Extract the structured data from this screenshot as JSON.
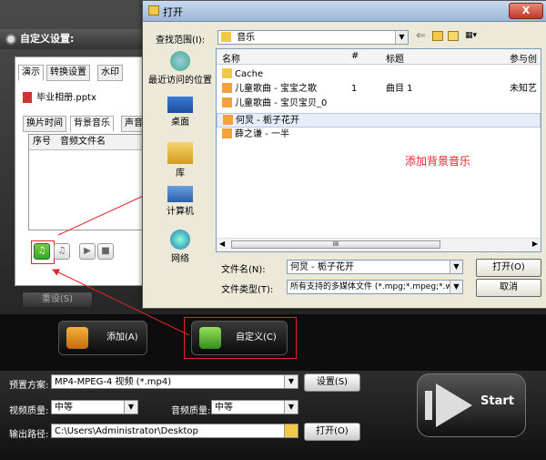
{
  "app": {
    "title": "自定义设置:",
    "tabs": [
      "演示",
      "转换设置",
      "水印"
    ],
    "file_name": "毕业相册.pptx",
    "subtabs": [
      "换片时间",
      "背景音乐",
      "声音"
    ],
    "table_headers": [
      "序号",
      "音频文件名"
    ],
    "reset_label": "重设(S)",
    "add_label": "添加(A)",
    "customize_label": "自定义(C)",
    "preset_label": "预置方案:",
    "preset_value": "MP4-MPEG-4 视频 (*.mp4)",
    "settings_label": "设置(S)",
    "video_quality_label": "视频质量:",
    "video_quality_value": "中等",
    "audio_quality_label": "音频质量:",
    "audio_quality_value": "中等",
    "output_path_label": "输出路径:",
    "output_path_value": "C:\\Users\\Administrator\\Desktop",
    "open_label": "打开(O)",
    "start_label": "Start"
  },
  "dialog": {
    "title": "打开",
    "close_label": "X",
    "look_in_label": "查找范围(I):",
    "look_in_value": "音乐",
    "places": [
      "最近访问的位置",
      "桌面",
      "库",
      "计算机",
      "网络"
    ],
    "columns": [
      "名称",
      "#",
      "标题",
      "参与创"
    ],
    "rows": [
      {
        "name": "Cache",
        "num": "",
        "title": "",
        "artist": ""
      },
      {
        "name": "儿童歌曲 - 宝宝之歌",
        "num": "1",
        "title": "曲目 1",
        "artist": "未知艺"
      },
      {
        "name": "儿童歌曲 - 宝贝宝贝_0",
        "num": "",
        "title": "",
        "artist": ""
      },
      {
        "name": "何炅 - 栀子花开",
        "num": "",
        "title": "",
        "artist": ""
      },
      {
        "name": "薛之谦 - 一半",
        "num": "",
        "title": "",
        "artist": ""
      }
    ],
    "scroll_grip": "III",
    "filename_label": "文件名(N):",
    "filename_value": "何炅 - 栀子花开",
    "filetype_label": "文件类型(T):",
    "filetype_value": "所有支持的多媒体文件 (*.mpg;*.mpeg;*.w",
    "open_button": "打开(O)",
    "cancel_button": "取消"
  },
  "annotation": "添加背景音乐",
  "colors": {
    "annotation": "#e0262a",
    "dialog_bg": "#ece9d8",
    "selection": "#e8eef8"
  }
}
